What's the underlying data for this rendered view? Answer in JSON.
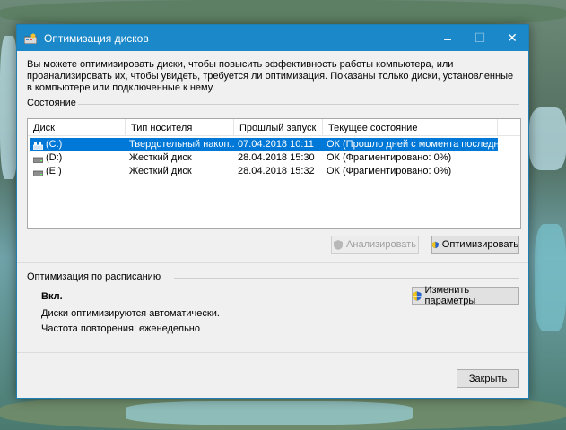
{
  "window": {
    "title": "Оптимизация дисков"
  },
  "description": "Вы можете оптимизировать диски, чтобы повысить эффективность работы  компьютера, или проанализировать их, чтобы увидеть, требуется ли оптимизация. Показаны только диски, установленные в компьютере или подключенные к нему.",
  "status_section": {
    "label": "Состояние",
    "columns": [
      "Диск",
      "Тип носителя",
      "Прошлый запуск",
      "Текущее состояние"
    ],
    "rows": [
      {
        "disk": "(C:)",
        "media": "Твердотельный накоп...",
        "last_run": "07.04.2018 10:11",
        "status": "ОК (Прошло дней с момента последне..."
      },
      {
        "disk": "(D:)",
        "media": "Жесткий диск",
        "last_run": "28.04.2018 15:30",
        "status": "ОК (Фрагментировано: 0%)"
      },
      {
        "disk": "(E:)",
        "media": "Жесткий диск",
        "last_run": "28.04.2018 15:32",
        "status": "ОК (Фрагментировано: 0%)"
      }
    ],
    "selected_row": 0
  },
  "buttons": {
    "analyze": "Анализировать",
    "optimize": "Оптимизировать",
    "change_settings": "Изменить параметры",
    "close": "Закрыть"
  },
  "schedule_section": {
    "label": "Оптимизация по расписанию",
    "state": "Вкл.",
    "auto_text": "Диски оптимизируются автоматически.",
    "frequency": "Частота повторения: еженедельно"
  },
  "colors": {
    "titlebar": "#1a88c9",
    "selection": "#0078d7"
  },
  "icons": [
    "app-defrag-icon",
    "minimize-icon",
    "maximize-icon",
    "close-icon",
    "ssd-drive-icon",
    "hdd-drive-icon",
    "uac-shield-icon"
  ]
}
